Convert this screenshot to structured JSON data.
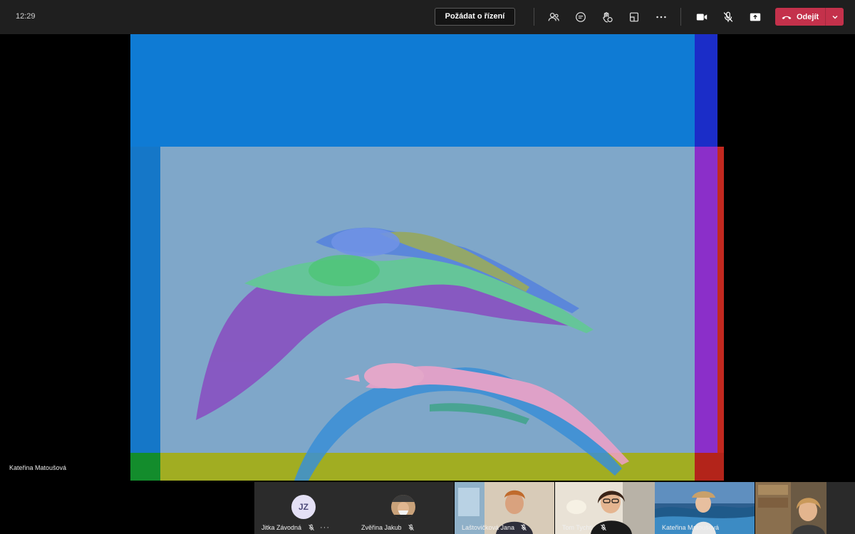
{
  "topbar": {
    "clock": "12:29",
    "request_control_label": "Požádat o řízení",
    "icons": [
      "participants-icon",
      "chat-icon",
      "reactions-icon",
      "room-icon",
      "more-icon",
      "camera-icon",
      "mic-off-icon",
      "share-tray-icon"
    ],
    "leave_label": "Odejít",
    "leave_color": "#c4314b"
  },
  "stage": {
    "presenter_name": "Kateřina Matoušová"
  },
  "participants": [
    {
      "name": "Jitka Závodná",
      "initials": "JZ",
      "muted": true
    },
    {
      "name": "Zvěřina Jakub",
      "muted": true
    },
    {
      "name": "Laštovičková Jana",
      "muted": true
    },
    {
      "name": "Tom Tychtl",
      "muted": true
    },
    {
      "name": "Kateřina Matoušová",
      "muted": false
    },
    {
      "name": "",
      "muted": false
    }
  ]
}
